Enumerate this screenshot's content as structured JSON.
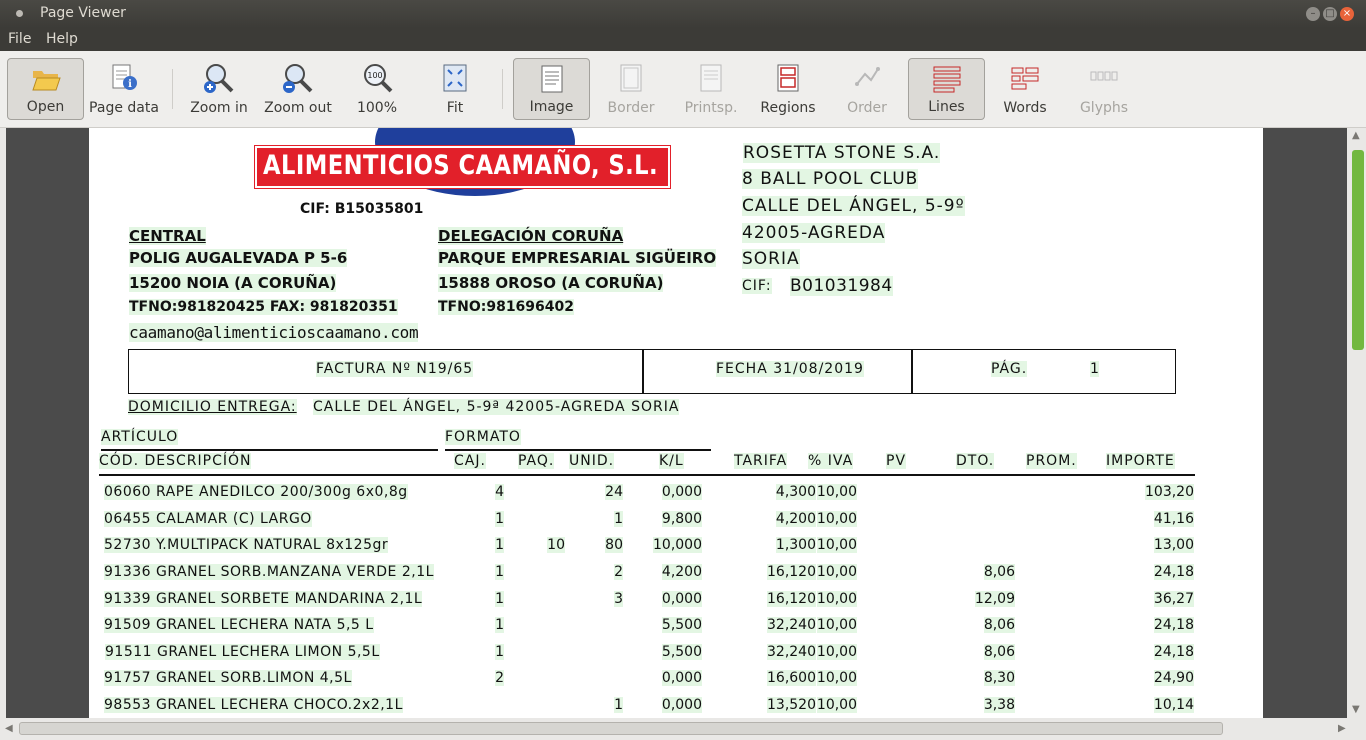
{
  "window": {
    "title": "Page Viewer"
  },
  "menu": [
    "File",
    "Help"
  ],
  "toolbar": {
    "open": "Open",
    "page_data": "Page data",
    "zoom_in": "Zoom in",
    "zoom_out": "Zoom out",
    "zoom_100": "100%",
    "fit": "Fit",
    "image": "Image",
    "border": "Border",
    "printsp": "Printsp.",
    "regions": "Regions",
    "order": "Order",
    "lines": "Lines",
    "words": "Words",
    "glyphs": "Glyphs"
  },
  "doc": {
    "company": "ALIMENTICIOS CAAMAÑO, S.L.",
    "cif": "CIF: B15035801",
    "central": {
      "title": "CENTRAL",
      "l1": "POLIG AUGALEVADA P 5-6",
      "l2": "15200 NOIA (A CORUÑA)",
      "l3": "TFNO:981820425    FAX: 981820351"
    },
    "delegacion": {
      "title": "DELEGACIÓN CORUÑA",
      "l1": "PARQUE EMPRESARIAL SIGÜEIRO",
      "l2": "15888 OROSO (A CORUÑA)",
      "l3": "TFNO:981696402"
    },
    "email": "caamano@alimenticioscaamano.com",
    "client": {
      "l1": "ROSETTA STONE S.A.",
      "l2": "8 BALL POOL CLUB",
      "l3": "CALLE DEL ÁNGEL, 5-9º",
      "l4": "42005-AGREDA",
      "l5": "SORIA",
      "cif_label": "CIF:",
      "cif": "B01031984"
    },
    "factura": "FACTURA Nº N19/65",
    "fecha": "FECHA  31/08/2019",
    "pag_label": "PÁG.",
    "pag": "1",
    "domicilio_label": "DOMICILIO ENTREGA:",
    "domicilio": "CALLE DEL ÁNGEL, 5-9ª 42005-AGREDA SORIA",
    "hdr": {
      "articulo": "ARTÍCULO",
      "formato": "FORMATO",
      "cod_desc": "CÓD.  DESCRIPCÍÓN",
      "caj": "CAJ.",
      "paq": "PAQ.",
      "unid": "UNID.",
      "kl": "K/L",
      "tarifa": "TARIFA",
      "iva": "% IVA",
      "pv": "PV",
      "dto": "DTO.",
      "prom": "PROM.",
      "importe": "IMPORTE"
    },
    "rows": [
      {
        "desc": "06060 RAPE ANEDILCO 200/300g 6x0,8g",
        "caj": "4",
        "paq": "",
        "unid": "24",
        "kl": "0,000",
        "tarifa": "4,300",
        "iva": "10,00",
        "dto": "",
        "importe": "103,20"
      },
      {
        "desc": "06455 CALAMAR (C) LARGO",
        "caj": "1",
        "paq": "",
        "unid": "1",
        "kl": "9,800",
        "tarifa": "4,200",
        "iva": "10,00",
        "dto": "",
        "importe": "41,16"
      },
      {
        "desc": "52730 Y.MULTIPACK NATURAL 8x125gr",
        "caj": "1",
        "paq": "10",
        "unid": "80",
        "kl": "10,000",
        "tarifa": "1,300",
        "iva": "10,00",
        "dto": "",
        "importe": "13,00"
      },
      {
        "desc": "91336 GRANEL SORB.MANZANA VERDE 2,1L",
        "caj": "1",
        "paq": "",
        "unid": "2",
        "kl": "4,200",
        "tarifa": "16,120",
        "iva": "10,00",
        "dto": "8,06",
        "importe": "24,18"
      },
      {
        "desc": "91339 GRANEL SORBETE MANDARINA 2,1L",
        "caj": "1",
        "paq": "",
        "unid": "3",
        "kl": "0,000",
        "tarifa": "16,120",
        "iva": "10,00",
        "dto": "12,09",
        "importe": "36,27"
      },
      {
        "desc": "91509 GRANEL LECHERA NATA 5,5 L",
        "caj": "1",
        "paq": "",
        "unid": "",
        "kl": "5,500",
        "tarifa": "32,240",
        "iva": "10,00",
        "dto": "8,06",
        "importe": "24,18"
      },
      {
        "desc": "91511 GRANEL LECHERA LIMON 5,5L",
        "caj": "1",
        "paq": "",
        "unid": "",
        "kl": "5,500",
        "tarifa": "32,240",
        "iva": "10,00",
        "dto": "8,06",
        "importe": "24,18"
      },
      {
        "desc": "91757 GRANEL SORB.LIMON 4,5L",
        "caj": "2",
        "paq": "",
        "unid": "",
        "kl": "0,000",
        "tarifa": "16,600",
        "iva": "10,00",
        "dto": "8,30",
        "importe": "24,90"
      },
      {
        "desc": "98553 GRANEL LECHERA CHOCO.2x2,1L",
        "caj": "",
        "paq": "",
        "unid": "1",
        "kl": "0,000",
        "tarifa": "13,520",
        "iva": "10,00",
        "dto": "3,38",
        "importe": "10,14"
      }
    ]
  },
  "colors": {
    "logo_red": "#e2202a",
    "logo_blue": "#1f3f9c",
    "line_highlight": "#e3f6e3",
    "scroll_thumb": "#72b83f"
  }
}
